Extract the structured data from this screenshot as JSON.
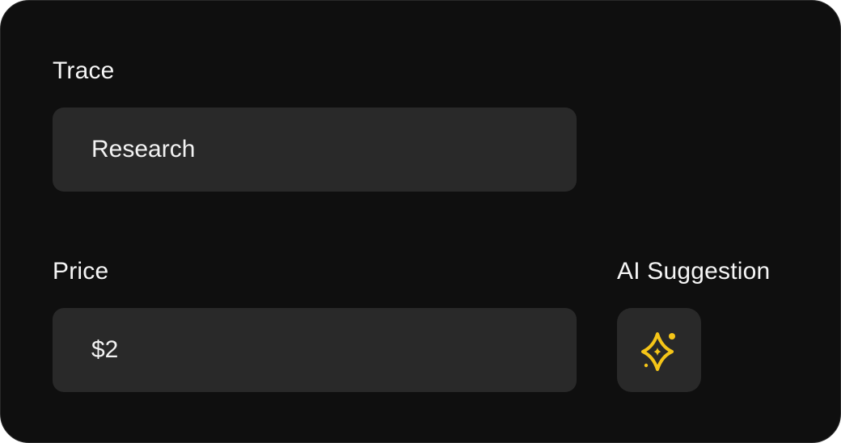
{
  "trace": {
    "label": "Trace",
    "value": "Research"
  },
  "price": {
    "label": "Price",
    "value": "$2"
  },
  "ai_suggestion": {
    "label": "AI Suggestion",
    "icon": "sparkle-icon",
    "icon_color": "#f5c518"
  },
  "colors": {
    "background": "#0f0f0f",
    "field": "#292929",
    "text": "#f5f5f5",
    "accent": "#f5c518"
  }
}
